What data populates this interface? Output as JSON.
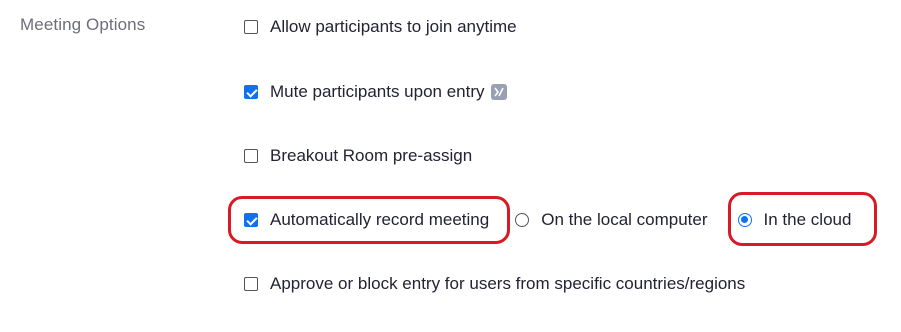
{
  "section": {
    "label": "Meeting Options"
  },
  "options": {
    "join_anytime": {
      "label": "Allow participants to join anytime",
      "checked": false
    },
    "mute_on_entry": {
      "label": "Mute participants upon entry",
      "checked": true,
      "icon": "locked-setting-icon"
    },
    "breakout_preassign": {
      "label": "Breakout Room pre-assign",
      "checked": false
    },
    "auto_record": {
      "label": "Automatically record meeting",
      "checked": true,
      "location": {
        "local": {
          "label": "On the local computer",
          "selected": false
        },
        "cloud": {
          "label": "In the cloud",
          "selected": true
        }
      }
    },
    "approve_block_countries": {
      "label": "Approve or block entry for users from specific countries/regions",
      "checked": false
    }
  },
  "colors": {
    "accent": "#0e72ed",
    "highlight": "#d81a26",
    "label_gray": "#6e6e7a",
    "text": "#232333"
  }
}
